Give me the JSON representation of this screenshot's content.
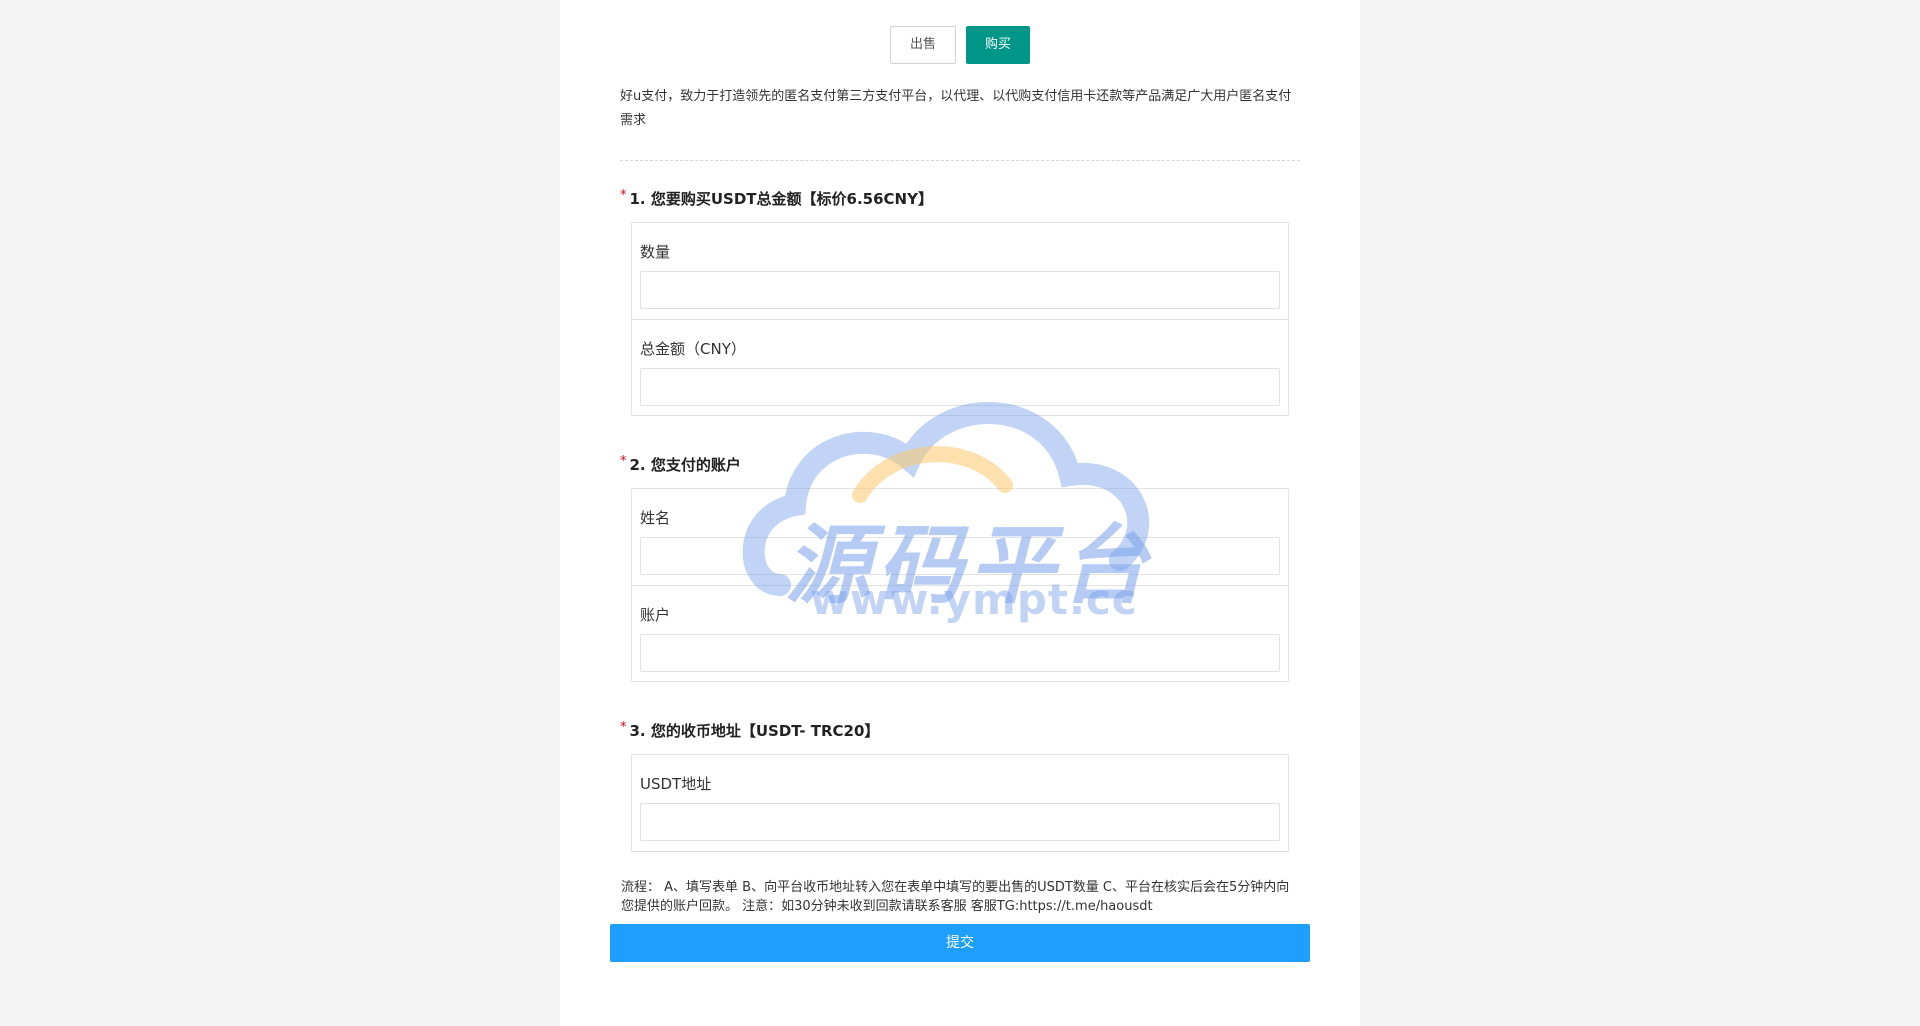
{
  "tabs": {
    "sell_label": "出售",
    "buy_label": "购买",
    "active": "buy"
  },
  "intro": "好u支付，致力于打造领先的匿名支付第三方支付平台，以代理、以代购支付信用卡还款等产品满足广大用户匿名支付需求",
  "sections": [
    {
      "required_mark": "*",
      "title": "1. 您要购买USDT总金额【标价6.56CNY】",
      "fields": [
        {
          "label": "数量",
          "value": "",
          "placeholder": ""
        },
        {
          "label": "总金额（CNY）",
          "value": "",
          "placeholder": ""
        }
      ]
    },
    {
      "required_mark": "*",
      "title": "2. 您支付的账户",
      "fields": [
        {
          "label": "姓名",
          "value": "",
          "placeholder": ""
        },
        {
          "label": "账户",
          "value": "",
          "placeholder": ""
        }
      ]
    },
    {
      "required_mark": "*",
      "title": "3. 您的收币地址【USDT- TRC20】",
      "fields": [
        {
          "label": "USDT地址",
          "value": "",
          "placeholder": ""
        }
      ]
    }
  ],
  "notice": "流程： A、填写表单 B、向平台收币地址转入您在表单中填写的要出售的USDT数量 C、平台在核实后会在5分钟内向您提供的账户回款。 注意：如30分钟未收到回款请联系客服 客服TG:https://t.me/haousdt",
  "submit_label": "提交",
  "watermark": {
    "title": "源码平台",
    "url": "www.ympt.cc"
  },
  "colors": {
    "buy_tab": "#009688",
    "submit": "#1e9fff",
    "required": "#e3001b"
  }
}
